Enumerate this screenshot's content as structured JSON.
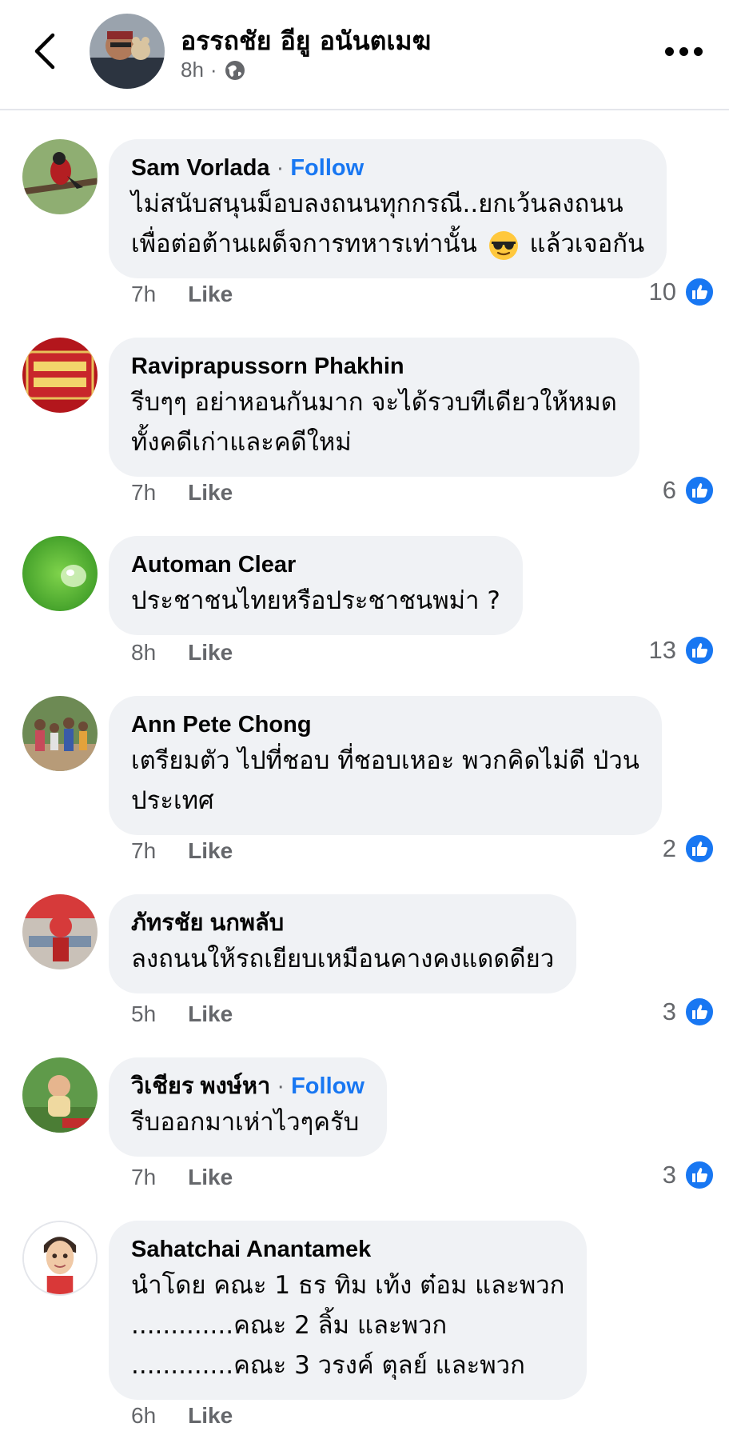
{
  "header": {
    "author": "อรรถชัย อียู อนันตเมฆ",
    "time": "8h",
    "separator": "·"
  },
  "comments": [
    {
      "name": "Sam Vorlada",
      "follow": "Follow",
      "lines": [
        "ไม่สนับสนุนม็อบลงถนนทุกกรณี..ยกเว้นลงถนน",
        "เพื่อต่อต้านเผด็จการทหารเท่านั้น",
        "แล้วเจอกัน"
      ],
      "time": "7h",
      "like": "Like",
      "count": "10"
    },
    {
      "name": "Raviprapussorn Phakhin",
      "lines": [
        "รีบๆๆ  อย่าหอนกันมาก  จะได้รวบทีเดียวให้หมด",
        "ทั้งคดีเก่าและคดีใหม่"
      ],
      "time": "7h",
      "like": "Like",
      "count": "6"
    },
    {
      "name": "Automan Clear",
      "lines": [
        "ประชาชนไทยหรือประชาชนพม่า ?"
      ],
      "time": "8h",
      "like": "Like",
      "count": "13"
    },
    {
      "name": "Ann Pete Chong",
      "lines": [
        "เตรียมตัว ไปที่ชอบ ที่ชอบเหอะ พวกคิดไม่ดี ป่วน",
        "ประเทศ"
      ],
      "time": "7h",
      "like": "Like",
      "count": "2"
    },
    {
      "name": "ภัทรชัย นกพลับ",
      "lines": [
        "ลงถนนให้รถเยียบเหมือนคางคงแดดดียว"
      ],
      "time": "5h",
      "like": "Like",
      "count": "3"
    },
    {
      "name": "วิเชียร พงษ์หา",
      "follow": "Follow",
      "lines": [
        "รีบออกมาเห่าไวๆครับ"
      ],
      "time": "7h",
      "like": "Like",
      "count": "3"
    },
    {
      "name": "Sahatchai Anantamek",
      "lines": [
        "นำโดย คณะ 1 ธร ทิม เท้ง ต๋อม และพวก",
        ".............คณะ 2 ลิ้ม และพวก",
        ".............คณะ 3 วรงค์ ตุลย์ และพวก"
      ],
      "time": "6h",
      "like": "Like"
    }
  ],
  "colors": {
    "accent": "#1877f2",
    "bubble": "#f0f2f5",
    "meta": "#65676b"
  },
  "icons": {
    "back": "chevron-left-icon",
    "more": "more-horizontal-icon",
    "globe": "globe-icon",
    "like": "thumbs-up-icon",
    "emoji": "sunglasses-emoji-icon"
  }
}
